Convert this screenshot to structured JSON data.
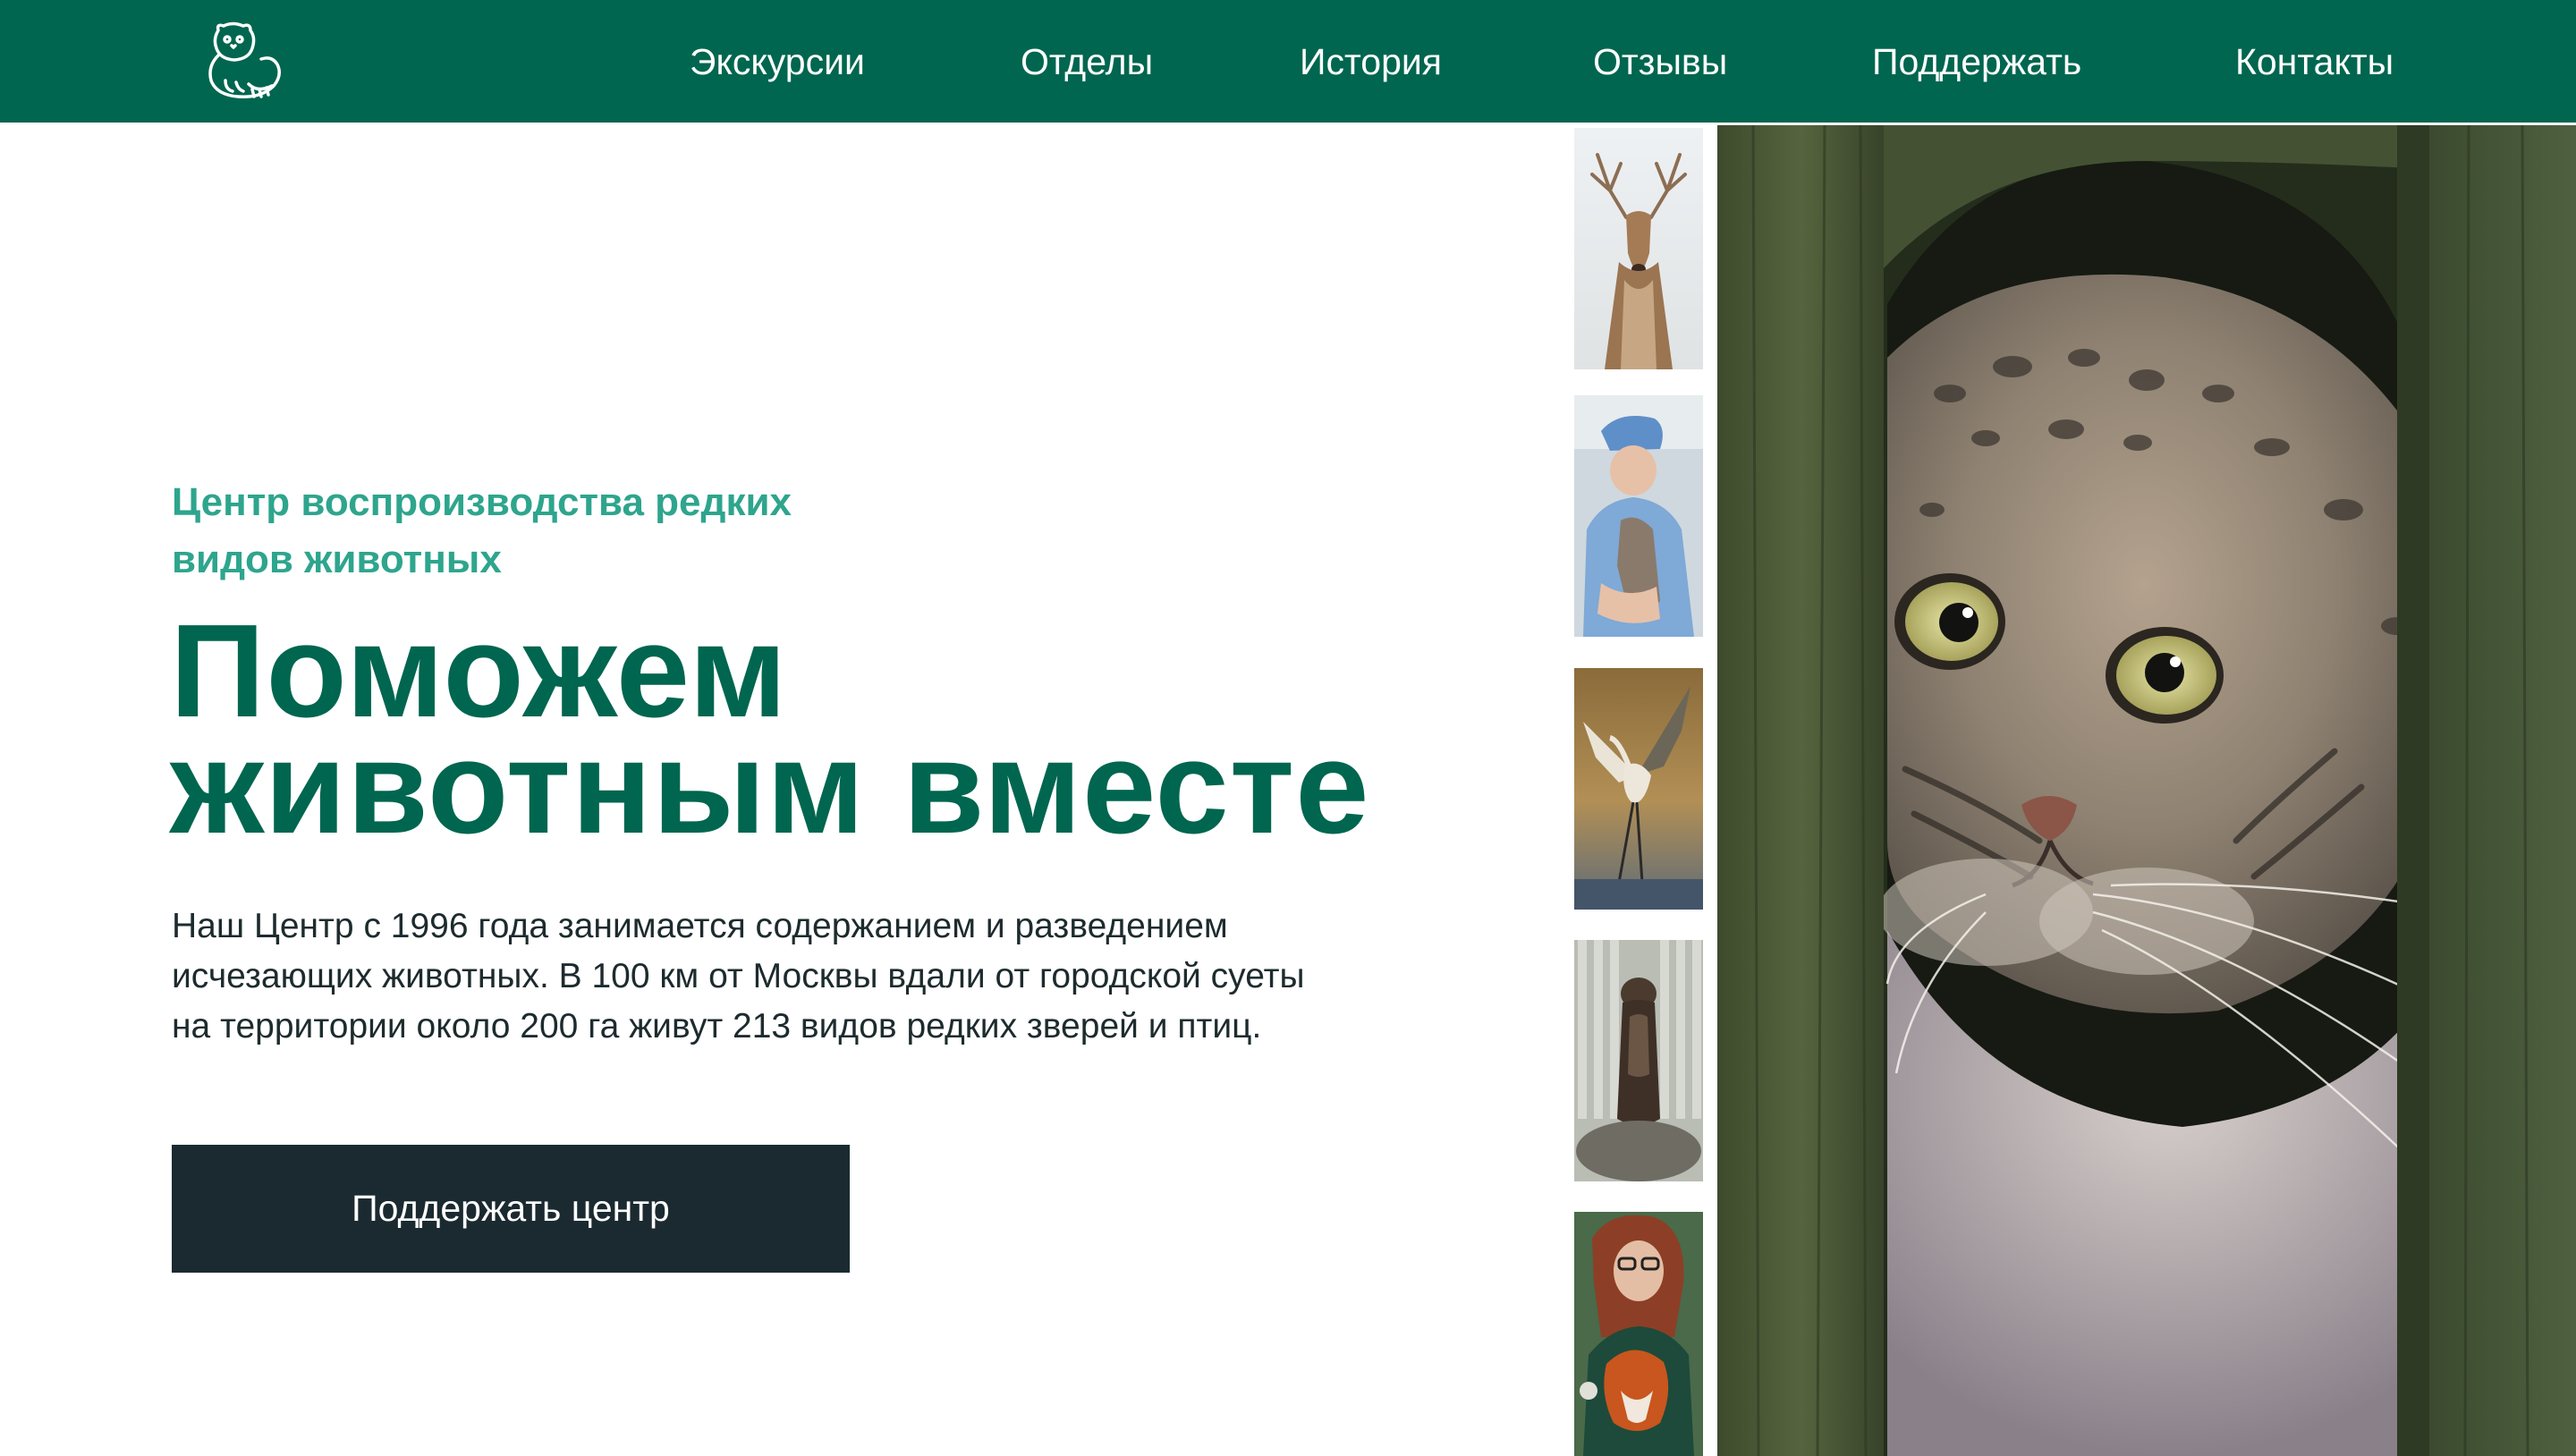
{
  "header": {
    "logo_icon": "manul-cat-logo-icon",
    "nav": [
      {
        "label": "Экскурсии"
      },
      {
        "label": "Отделы"
      },
      {
        "label": "История"
      },
      {
        "label": "Отзывы"
      },
      {
        "label": "Поддержать"
      },
      {
        "label": "Контакты"
      }
    ]
  },
  "hero": {
    "eyebrow_line1": "Центр воспроизводства редких",
    "eyebrow_line2": "видов животных",
    "title_line1": "Поможем",
    "title_line2": "животным вместе",
    "lead_line1": "Наш Центр с 1996 года занимается содержанием и разведением",
    "lead_line2": "исчезающих животных. В 100 км от Москвы вдали от городской суеты",
    "lead_line3": "на территории около 200 га живут 213 видов редких зверей и птиц.",
    "cta_label": "Поддержать центр"
  },
  "gallery": {
    "thumbnails": [
      {
        "subject": "deer"
      },
      {
        "subject": "veterinarian-with-animal"
      },
      {
        "subject": "crane-bird"
      },
      {
        "subject": "otter"
      },
      {
        "subject": "woman-with-fox"
      }
    ],
    "main_photo": {
      "subject": "manul-cat"
    }
  },
  "colors": {
    "brand_green": "#00664f",
    "accent_teal": "#2ea58d",
    "cta_dark": "#1b2a30",
    "body_text": "#1d2b2e"
  }
}
